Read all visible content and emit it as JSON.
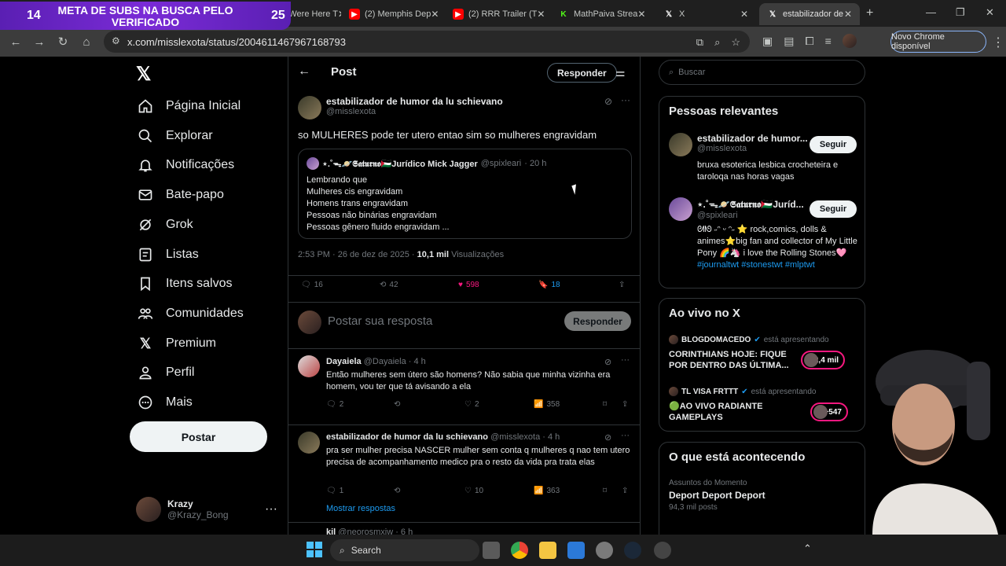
{
  "overlay": {
    "left_num": "14",
    "text": "META DE SUBS NA BUSCA PELO VERIFICADO",
    "right_num": "25"
  },
  "tabs": [
    {
      "label": "We Were Here T",
      "icon": "page-icon"
    },
    {
      "label": "(2) Memphis Dep",
      "icon": "youtube-icon"
    },
    {
      "label": "(2) RRR Trailer (T",
      "icon": "youtube-icon"
    },
    {
      "label": "MathPaiva Strea",
      "icon": "kick-icon"
    },
    {
      "label": "X",
      "icon": "x-icon"
    },
    {
      "label": "estabilizador de",
      "icon": "x-icon",
      "active": true
    }
  ],
  "browser": {
    "url": "x.com/misslexota/status/2004611467967168793",
    "update_label": "Novo Chrome disponível"
  },
  "leftnav": {
    "items": [
      {
        "label": "Página Inicial",
        "icon": "home-icon"
      },
      {
        "label": "Explorar",
        "icon": "search-icon"
      },
      {
        "label": "Notificações",
        "icon": "bell-icon"
      },
      {
        "label": "Bate-papo",
        "icon": "mail-icon"
      },
      {
        "label": "Grok",
        "icon": "grok-icon"
      },
      {
        "label": "Listas",
        "icon": "list-icon"
      },
      {
        "label": "Itens salvos",
        "icon": "bookmark-icon"
      },
      {
        "label": "Comunidades",
        "icon": "communities-icon"
      },
      {
        "label": "Premium",
        "icon": "x-icon"
      },
      {
        "label": "Perfil",
        "icon": "person-icon"
      },
      {
        "label": "Mais",
        "icon": "more-circle-icon"
      }
    ],
    "post_label": "Postar",
    "profile": {
      "name": "Krazy",
      "handle": "@Krazy_Bong"
    }
  },
  "main": {
    "header_title": "Post",
    "reply_pill": "Responder",
    "post": {
      "author_name": "estabilizador de humor da lu schievano",
      "author_handle": "@misslexota",
      "text": "so MULHERES pode ter utero entao sim so mulheres engravidam",
      "quote": {
        "name": "⋆.˚ᯓ🪐𝕾𝖆𝖙𝖚𝖗𝖓𝖔🇵🇸Jurídico Mick Jagger",
        "handle": "@spixleari",
        "time": "· 20 h",
        "lines": [
          "Lembrando que",
          "Mulheres cis engravidam",
          "Homens trans engravidam",
          "Pessoas não binárias engravidam",
          "Pessoas gênero fluido engravidam ..."
        ]
      },
      "time": "2:53 PM · 26 de dez de 2025 ·",
      "views": "10,1 mil",
      "views_label": "Visualizações",
      "replies": "16",
      "reposts": "42",
      "likes": "598",
      "bookmarks": "18"
    },
    "compose": {
      "placeholder": "Postar sua resposta",
      "button": "Responder"
    },
    "replies": [
      {
        "name": "Dayaiela",
        "handle": "@Dayaiela · 4 h",
        "text": "Então mulheres sem útero são homens? Não sabia que minha vizinha era homem, vou ter que tá avisando a ela",
        "replies": "2",
        "reposts": "",
        "likes": "2",
        "views": "358"
      },
      {
        "name": "estabilizador de humor da lu schievano",
        "handle": "@misslexota · 4 h",
        "text": "pra ser mulher precisa NASCER mulher sem conta q mulheres q nao tem utero precisa de acompanhamento medico pra o resto da vida pra trata elas",
        "replies": "1",
        "reposts": "",
        "likes": "10",
        "views": "363"
      }
    ],
    "show_replies": "Mostrar respostas",
    "next_reply": {
      "name": "kil",
      "handle": "@neorosmxiw · 6 h"
    }
  },
  "right": {
    "search_placeholder": "Buscar",
    "relevant_title": "Pessoas relevantes",
    "people": [
      {
        "name": "estabilizador de humor...",
        "handle": "@misslexota",
        "bio": "bruxa esoterica lesbica crocheteira e taroloqa nas horas vagas",
        "follow": "Seguir"
      },
      {
        "name": "⋆.˚ᯓ🪐𝕾𝖆𝖙𝖚𝖗𝖓𝖔🇵🇸Juríd...",
        "handle": "@spixleari",
        "bio": "ᘛᘚ    ˶ᵔ ᵕ ᵔ˶    ⭐ rock,comics, dolls & animes⭐big fan and collector of My Little Pony 🌈🦄 i love the Rolling Stones🩷",
        "tags": "#journaltwt #stonestwt #mlptwt",
        "follow": "Seguir"
      }
    ],
    "live_title": "Ao vivo no X",
    "live": [
      {
        "host": "BLOGDOMACEDO",
        "status": "está apresentando",
        "title": "CORINTHIANS HOJE: FIQUE POR DENTRO DAS ÚLTIMA...",
        "count": "+2,4 mil"
      },
      {
        "host": "TL VISA FRTTT",
        "status": "está apresentando",
        "title": "🟢AO VIVO RADIANTE GAMEPLAYS",
        "count": "+547"
      }
    ],
    "trending_title": "O que está acontecendo",
    "trend": {
      "context": "Assuntos do Momento",
      "name": "Deport Deport Deport",
      "posts": "94,3 mil posts"
    }
  },
  "taskbar": {
    "search_label": "Search"
  }
}
